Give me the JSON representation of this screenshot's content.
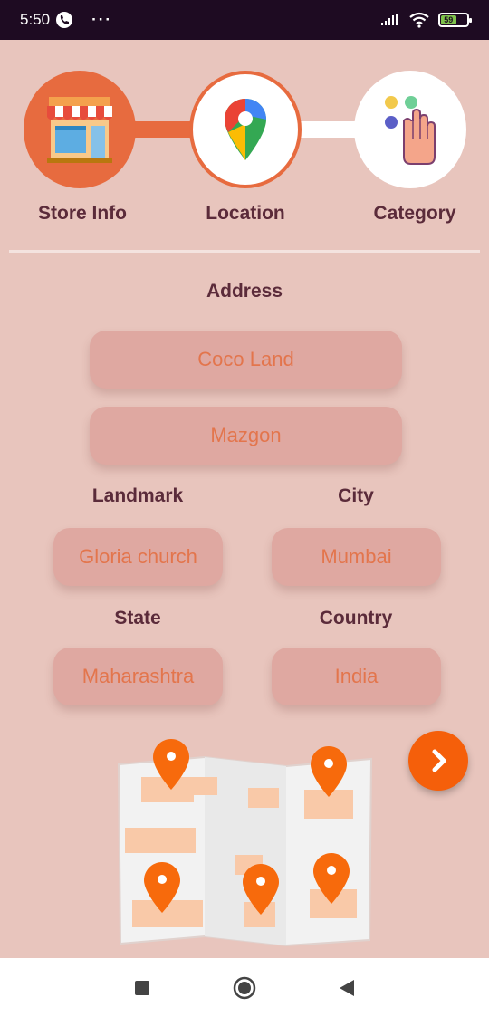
{
  "status_bar": {
    "time": "5:50",
    "overflow": "···",
    "battery": "59"
  },
  "stepper": {
    "steps": [
      {
        "label": "Store Info",
        "icon": "store-icon"
      },
      {
        "label": "Location",
        "icon": "map-pin-icon"
      },
      {
        "label": "Category",
        "icon": "hand-touch-icon"
      }
    ]
  },
  "form": {
    "address_title": "Address",
    "address_line1": "Coco Land",
    "address_line2": "Mazgon",
    "landmark_label": "Landmark",
    "landmark_value": "Gloria church",
    "city_label": "City",
    "city_value": "Mumbai",
    "state_label": "State",
    "state_value": "Maharashtra",
    "country_label": "Country",
    "country_value": "India"
  },
  "colors": {
    "background": "#e8c5bd",
    "accent": "#e76b3f",
    "button": "#f55f0a",
    "field": "#dfa8a1",
    "label_text": "#5b2b3a"
  }
}
